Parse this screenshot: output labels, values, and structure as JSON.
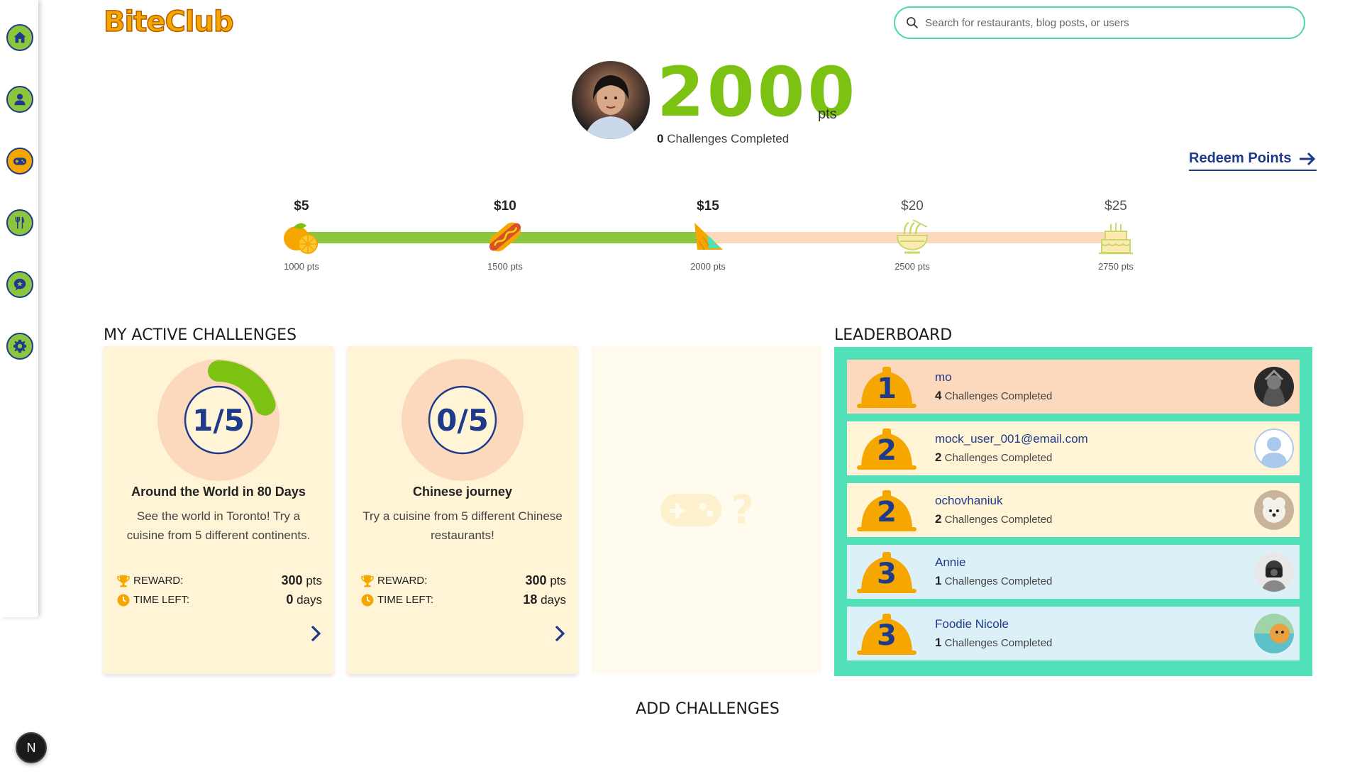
{
  "app": {
    "logo_text": "BiteClub"
  },
  "search": {
    "placeholder": "Search for restaurants, blog posts, or users"
  },
  "sidebar": {
    "items": [
      {
        "name": "home",
        "icon": "home-icon",
        "active": false
      },
      {
        "name": "profile",
        "icon": "user-icon",
        "active": false
      },
      {
        "name": "challenges",
        "icon": "gamepad-icon",
        "active": true
      },
      {
        "name": "restaurants",
        "icon": "fork-knife-icon",
        "active": false
      },
      {
        "name": "blog",
        "icon": "chat-star-icon",
        "active": false
      },
      {
        "name": "settings",
        "icon": "gear-icon",
        "active": false
      }
    ]
  },
  "profile": {
    "points": "2000",
    "points_unit": "pts",
    "challenges_completed_count": "0",
    "challenges_completed_label": "Challenges Completed"
  },
  "redeem": {
    "label": "Redeem Points"
  },
  "rewards": [
    {
      "price": "$5",
      "pts": "1000 pts",
      "icon": "lemon-icon",
      "unlocked": true
    },
    {
      "price": "$10",
      "pts": "1500 pts",
      "icon": "hotdog-icon",
      "unlocked": true
    },
    {
      "price": "$15",
      "pts": "2000 pts",
      "icon": "taco-icon",
      "unlocked": true
    },
    {
      "price": "$20",
      "pts": "2500 pts",
      "icon": "noodles-icon",
      "unlocked": false
    },
    {
      "price": "$25",
      "pts": "2750 pts",
      "icon": "cake-icon",
      "unlocked": false
    }
  ],
  "progress_fraction": 0.5,
  "active_challenges": {
    "title": "MY ACTIVE CHALLENGES",
    "cards": [
      {
        "progress": "1/5",
        "progress_fraction": 0.2,
        "title": "Around the World in 80 Days",
        "description": "See the world in Toronto! Try a cuisine from 5 different continents.",
        "reward_label": "REWARD:",
        "reward_value": "300",
        "reward_unit": "pts",
        "time_label": "TIME LEFT:",
        "time_value": "0",
        "time_unit": "days"
      },
      {
        "progress": "0/5",
        "progress_fraction": 0,
        "title": "Chinese journey",
        "description": "Try a cuisine from 5 different Chinese restaurants!",
        "reward_label": "REWARD:",
        "reward_value": "300",
        "reward_unit": "pts",
        "time_label": "TIME LEFT:",
        "time_value": "18",
        "time_unit": "days"
      }
    ]
  },
  "leaderboard": {
    "title": "LEADERBOARD",
    "rows": [
      {
        "rank": "1",
        "name": "mo",
        "count": "4",
        "label": "Challenges Completed",
        "bg": "#fcd9bd"
      },
      {
        "rank": "2",
        "name": "mock_user_001@email.com",
        "count": "2",
        "label": "Challenges Completed",
        "bg": "#fff4d6"
      },
      {
        "rank": "2",
        "name": "ochovhaniuk",
        "count": "2",
        "label": "Challenges Completed",
        "bg": "#fff4d6"
      },
      {
        "rank": "3",
        "name": "Annie",
        "count": "1",
        "label": "Challenges Completed",
        "bg": "#dcf0f8"
      },
      {
        "rank": "3",
        "name": "Foodie Nicole",
        "count": "1",
        "label": "Challenges Completed",
        "bg": "#dcf0f8"
      }
    ]
  },
  "add_challenges": {
    "label": "ADD CHALLENGES"
  },
  "dev_badge": {
    "label": "N"
  },
  "colors": {
    "accent_green": "#7cc212",
    "accent_orange": "#f5a700",
    "navy": "#1e3a8a",
    "teal": "#52e0b9",
    "peach": "#fcd9bd",
    "cream": "#fff4d6"
  }
}
